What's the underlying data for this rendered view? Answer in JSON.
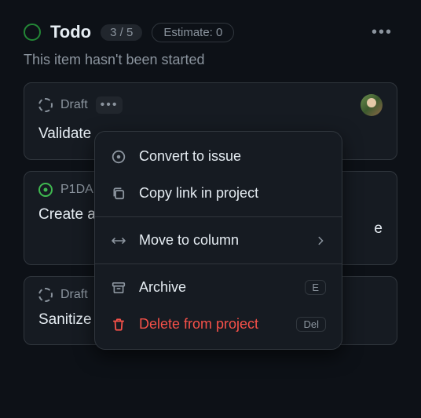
{
  "column": {
    "title": "Todo",
    "count": "3 / 5",
    "estimate": "Estimate: 0",
    "subtitle": "This item hasn't been started"
  },
  "cards": [
    {
      "status": "draft",
      "status_label": "Draft",
      "title": "Validate",
      "has_avatar": true,
      "has_menu_open": true
    },
    {
      "status": "issue",
      "status_label": "P1DA",
      "title": "Create a JSON file",
      "has_avatar": false,
      "truncated_suffix": "e"
    },
    {
      "status": "draft",
      "status_label": "Draft",
      "title": "Sanitize",
      "has_avatar": false
    }
  ],
  "menu": {
    "convert": "Convert to issue",
    "copy": "Copy link in project",
    "move": "Move to column",
    "archive": "Archive",
    "archive_key": "E",
    "delete": "Delete from project",
    "delete_key": "Del"
  }
}
